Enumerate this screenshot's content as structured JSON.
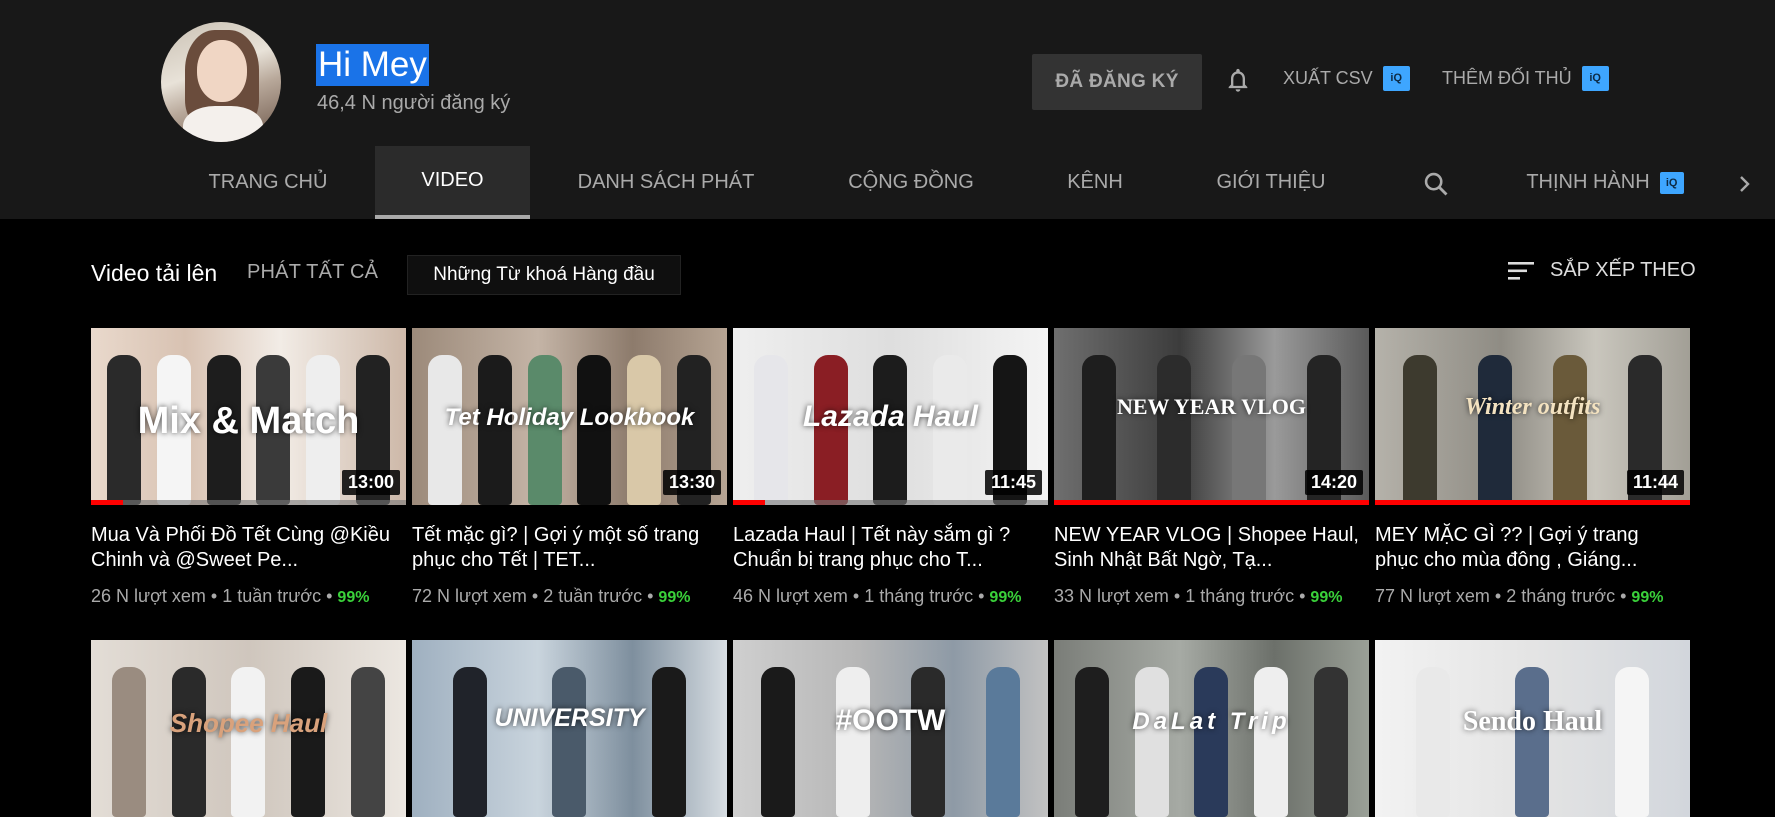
{
  "channel": {
    "name": "Hi Mey",
    "subscribers": "46,4 N người đăng ký",
    "subscribe_label": "ĐÃ ĐĂNG KÝ",
    "export_csv_label": "XUẤT CSV",
    "add_competitor_label": "THÊM ĐỐI THỦ",
    "ext_badge": "iQ"
  },
  "tabs": [
    {
      "label": "TRANG CHỦ"
    },
    {
      "label": "VIDEO"
    },
    {
      "label": "DANH SÁCH PHÁT"
    },
    {
      "label": "CỘNG ĐỒNG"
    },
    {
      "label": "KÊNH"
    },
    {
      "label": "GIỚI THIỆU"
    },
    {
      "label": "THỊNH HÀNH"
    }
  ],
  "toolbar": {
    "uploads_title": "Video tải lên",
    "play_all": "PHÁT TẤT CẢ",
    "keywords_chip": "Những Từ khoá Hàng đầu",
    "sort_label": "SẮP XẾP THEO"
  },
  "videos": [
    {
      "overlay": "Mix & Match",
      "duration": "13:00",
      "progress": 0.1,
      "title": "Mua Và Phối Đồ Tết Cùng @Kiều Chinh và @Sweet Pe...",
      "views": "26 N lượt xem",
      "age": "1 tuần trước",
      "score": "99%"
    },
    {
      "overlay": "Tet Holiday Lookbook",
      "duration": "13:30",
      "progress": 0,
      "title": "Tết mặc gì? | Gợi ý một số trang phục cho Tết | TET...",
      "views": "72 N lượt xem",
      "age": "2 tuần trước",
      "score": "99%"
    },
    {
      "overlay": "Lazada Haul",
      "duration": "11:45",
      "progress": 0.1,
      "title": "Lazada Haul | Tết này sắm gì ? Chuẩn bị trang phục cho T...",
      "views": "46 N lượt xem",
      "age": "1 tháng trước",
      "score": "99%"
    },
    {
      "overlay": "NEW YEAR VLOG",
      "duration": "14:20",
      "progress": 1,
      "title": "NEW YEAR VLOG | Shopee Haul, Sinh Nhật Bất Ngờ, Tạ...",
      "views": "33 N lượt xem",
      "age": "1 tháng trước",
      "score": "99%"
    },
    {
      "overlay": "Winter outfits",
      "duration": "11:44",
      "progress": 1,
      "title": "MEY MẶC GÌ ?? | Gợi ý trang phục cho mùa đông , Giáng...",
      "views": "77 N lượt xem",
      "age": "2 tháng trước",
      "score": "99%"
    },
    {
      "overlay": "Shopee Haul"
    },
    {
      "overlay": "UNIVERSITY"
    },
    {
      "overlay": "#OOTW"
    },
    {
      "overlay": "DaLat Trip"
    },
    {
      "overlay": "Sendo Haul"
    }
  ],
  "colors": {
    "header_bg": "#181818",
    "page_bg": "#000000",
    "selection": "#1a73e8",
    "progress": "#ff0000",
    "score": "#3ad13a",
    "ext_badge": "#3ea6ff"
  }
}
